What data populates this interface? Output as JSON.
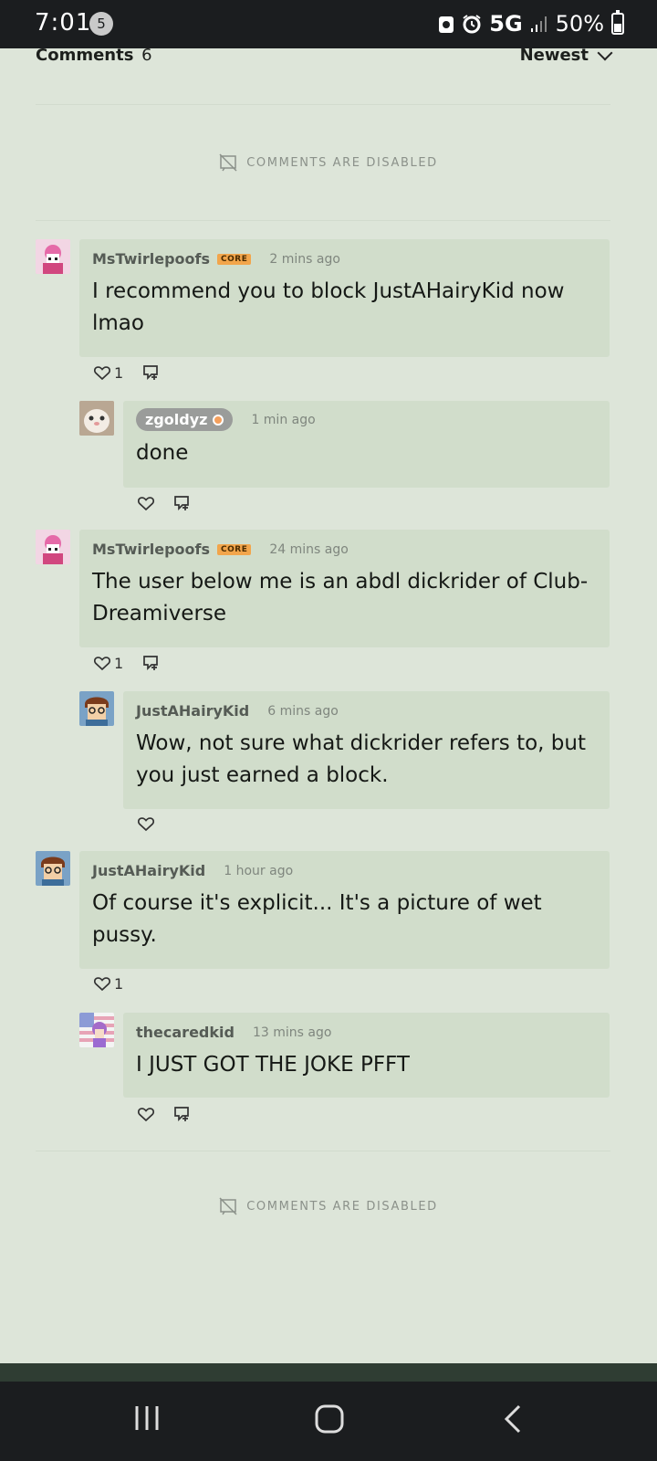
{
  "status_bar": {
    "time": "7:01",
    "notification_count": "5",
    "network": "5G",
    "battery": "50%"
  },
  "header": {
    "title": "Comments",
    "count": "6",
    "sort_label": "Newest"
  },
  "disabled_notice": "COMMENTS ARE DISABLED",
  "comments": [
    {
      "user": "MsTwirlepoofs",
      "badge": "CORE",
      "time": "2 mins ago",
      "text": "I recommend you to block JustAHairyKid now lmao",
      "likes": "1"
    },
    {
      "user": "zgoldyz",
      "time": "1 min ago",
      "text": "done"
    },
    {
      "user": "MsTwirlepoofs",
      "badge": "CORE",
      "time": "24 mins ago",
      "text": "The user below me is an abdl dickrider of Club-Dreamiverse",
      "likes": "1"
    },
    {
      "user": "JustAHairyKid",
      "time": "6 mins ago",
      "text": "Wow, not sure what dickrider refers to, but you just earned a block."
    },
    {
      "user": "JustAHairyKid",
      "time": "1 hour ago",
      "text": "Of course it's explicit... It's a picture of wet pussy.",
      "likes": "1"
    },
    {
      "user": "thecaredkid",
      "time": "13 mins ago",
      "text": "I JUST GOT THE JOKE PFFT"
    }
  ],
  "colors": {
    "page_bg": "#dde5d9",
    "bubble_bg": "#d1ddcb",
    "core_badge": "#f2a54b"
  }
}
